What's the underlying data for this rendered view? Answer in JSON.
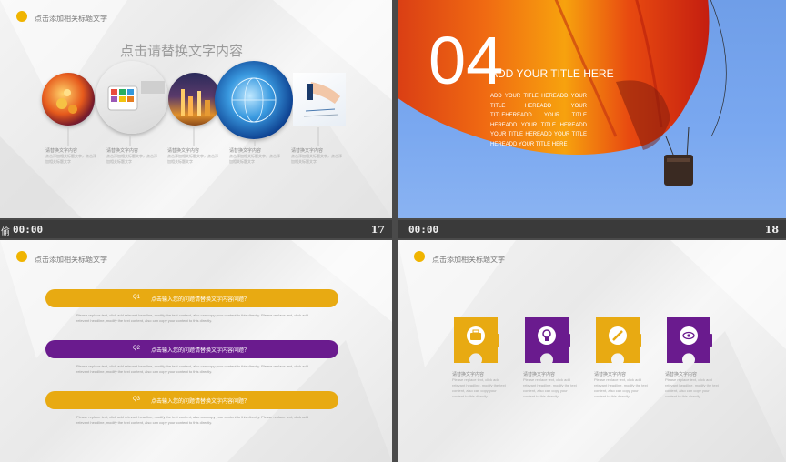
{
  "colors": {
    "gold": "#e8aa12",
    "purple": "#6a1b8e",
    "status_bg": "#3a3a3a"
  },
  "slide1": {
    "title": "点击添加相关标题文字",
    "heading": "点击请替换文字内容",
    "items": [
      {
        "caption": "请替换文字内容",
        "body": "点击添加相关标题文字，点击添加相关标题文字"
      },
      {
        "caption": "请替换文字内容",
        "body": "点击添加相关标题文字，点击添加相关标题文字"
      },
      {
        "caption": "请替换文字内容",
        "body": "点击添加相关标题文字，点击添加相关标题文字"
      },
      {
        "caption": "请替换文字内容",
        "body": "点击添加相关标题文字，点击添加相关标题文字"
      },
      {
        "caption": "请替换文字内容",
        "body": "点击添加相关标题文字，点击添加相关标题文字"
      }
    ],
    "status": {
      "glyph": "偷",
      "time": "00:00",
      "number": "17"
    }
  },
  "slide2": {
    "big_number": "04",
    "heading": "ADD YOUR TITLE HERE",
    "body": "ADD YOUR TITLE HEREADD YOUR TITLE HEREADD YOUR TITLEHEREADD YOUR TITLE HEREADD YOUR TITLE HEREADD YOUR TITLE HEREADD YOUR TITLE HEREADD YOUR TITLE HERE",
    "status": {
      "time": "00:00",
      "number": "18"
    }
  },
  "slide3": {
    "title": "点击添加相关标题文字",
    "questions": [
      {
        "q": "Q1",
        "text": "点击输入您的问题请替换文字内容问题？",
        "desc": "Please replace text, click add relevant headline, modify the text content, also can copy your content to this directly. Please replace text, click add relevant headline, modify the text content, also can copy your content to this directly."
      },
      {
        "q": "Q2",
        "text": "点击输入您的问题请替换文字内容问题？",
        "desc": "Please replace text, click add relevant headline, modify the text content, also can copy your content to this directly. Please replace text, click add relevant headline, modify the text content, also can copy your content to this directly."
      },
      {
        "q": "Q3",
        "text": "点击输入您的问题请替换文字内容问题？",
        "desc": "Please replace text, click add relevant headline, modify the text content, also can copy your content to this directly. Please replace text, click add relevant headline, modify the text content, also can copy your content to this directly."
      }
    ]
  },
  "slide4": {
    "title": "点击添加相关标题文字",
    "pieces": [
      {
        "icon": "briefcase-icon",
        "caption": "请替换文字内容",
        "body": "Please replace text, click add relevant headline, modify the text content, also can copy your content to this directly."
      },
      {
        "icon": "lightbulb-icon",
        "caption": "请替换文字内容",
        "body": "Please replace text, click add relevant headline, modify the text content, also can copy your content to this directly."
      },
      {
        "icon": "pencil-icon",
        "caption": "请替换文字内容",
        "body": "Please replace text, click add relevant headline, modify the text content, also can copy your content to this directly."
      },
      {
        "icon": "eye-icon",
        "caption": "请替换文字内容",
        "body": "Please replace text, click add relevant headline, modify the text content, also can copy your content to this directly."
      }
    ]
  }
}
